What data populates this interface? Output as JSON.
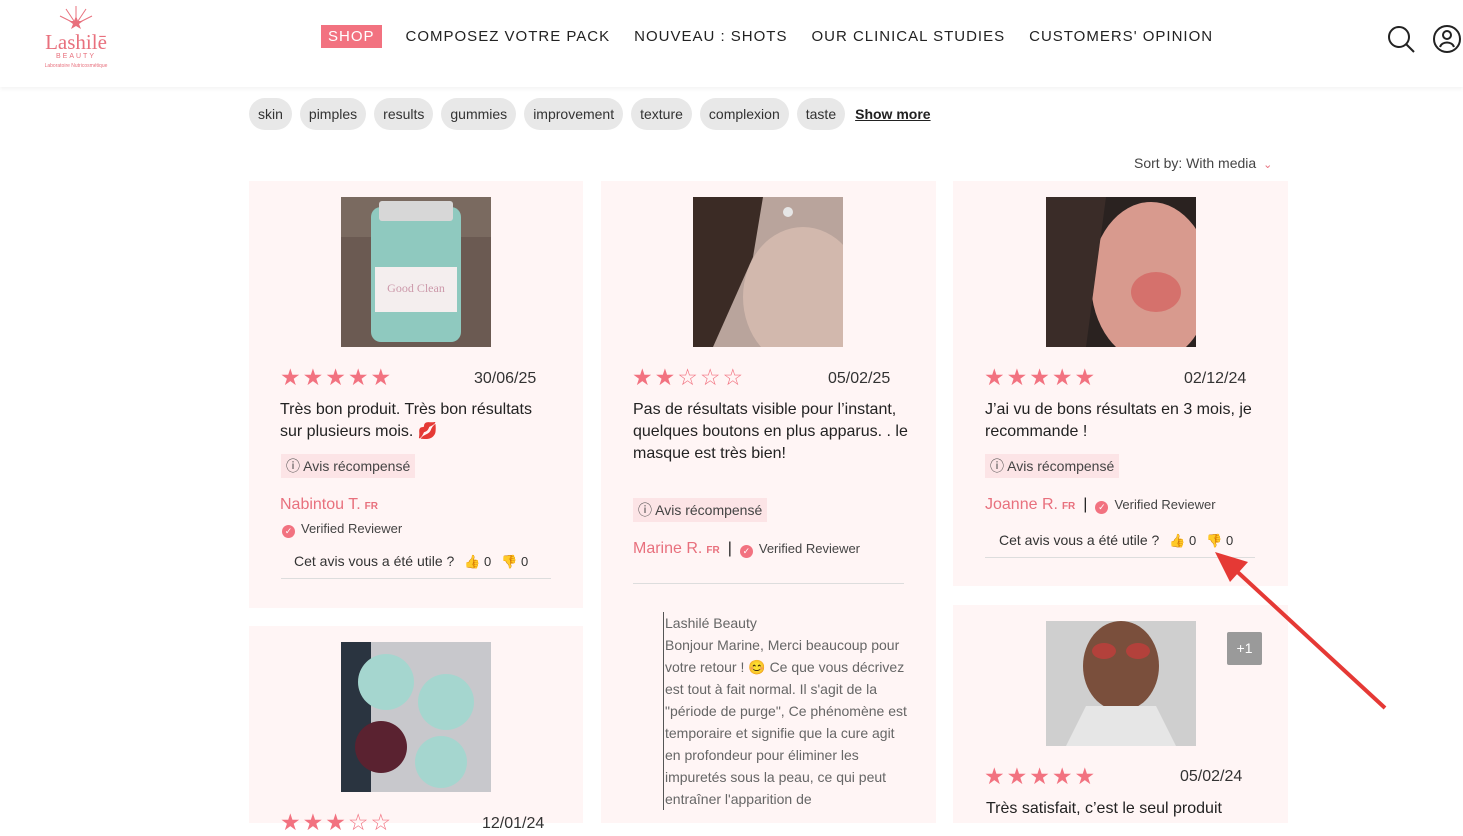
{
  "header": {
    "logo": {
      "name": "Lashilē",
      "sub": "BEAUTY",
      "tagline": "Laboratoire Nutricosmétique"
    },
    "nav": [
      {
        "label": "SHOP"
      },
      {
        "label": "COMPOSEZ VOTRE PACK"
      },
      {
        "label": "NOUVEAU : SHOTS"
      },
      {
        "label": "OUR CLINICAL STUDIES"
      },
      {
        "label": "CUSTOMERS' OPINION"
      }
    ],
    "icons": [
      "search-icon",
      "account-icon"
    ]
  },
  "tags": {
    "items": [
      "skin",
      "pimples",
      "results",
      "gummies",
      "improvement",
      "texture",
      "complexion",
      "taste"
    ],
    "show_more": "Show more"
  },
  "sort": {
    "label": "Sort by:",
    "value": "With media"
  },
  "reviews": [
    {
      "rating": 5,
      "date": "30/06/25",
      "text": "Très bon produit. Très bon résultats sur plusieurs mois. 💋",
      "badge": "Avis récompensé",
      "author": "Nabintou T.",
      "country": "FR",
      "verified": "Verified Reviewer",
      "helpful_question": "Cet avis vous a été utile ?",
      "up": "0",
      "down": "0"
    },
    {
      "rating": 2,
      "date": "05/02/25",
      "text": "Pas de résultats visible pour l’instant, quelques boutons en plus apparus. . le masque est très bien!",
      "badge": "Avis récompensé",
      "author": "Marine R.",
      "country": "FR",
      "verified": "Verified Reviewer",
      "reply_author": "Lashilé Beauty",
      "reply_text": "Bonjour Marine, Merci beaucoup pour votre retour ! 😊 Ce que vous décrivez est tout à fait normal. Il s'agit de la \"période de purge\", Ce phénomène est temporaire et signifie que la cure agit en profondeur pour éliminer les impuretés sous la peau, ce qui peut entraîner l'apparition de"
    },
    {
      "rating": 5,
      "date": "02/12/24",
      "text": "J’ai vu de bons résultats en 3 mois, je recommande !",
      "badge": "Avis récompensé",
      "author": "Joanne R.",
      "country": "FR",
      "verified": "Verified Reviewer",
      "helpful_question": "Cet avis vous a été utile ?",
      "up": "0",
      "down": "0"
    },
    {
      "rating": 3,
      "date": "12/01/24"
    },
    {
      "rating": 5,
      "date": "05/02/24",
      "text": "Très satisfait, c’est le seul produit",
      "more_media": "+1"
    }
  ],
  "colors": {
    "accent": "#f27280",
    "card_bg": "#fff5f5",
    "annotation_arrow": "#e53935"
  }
}
